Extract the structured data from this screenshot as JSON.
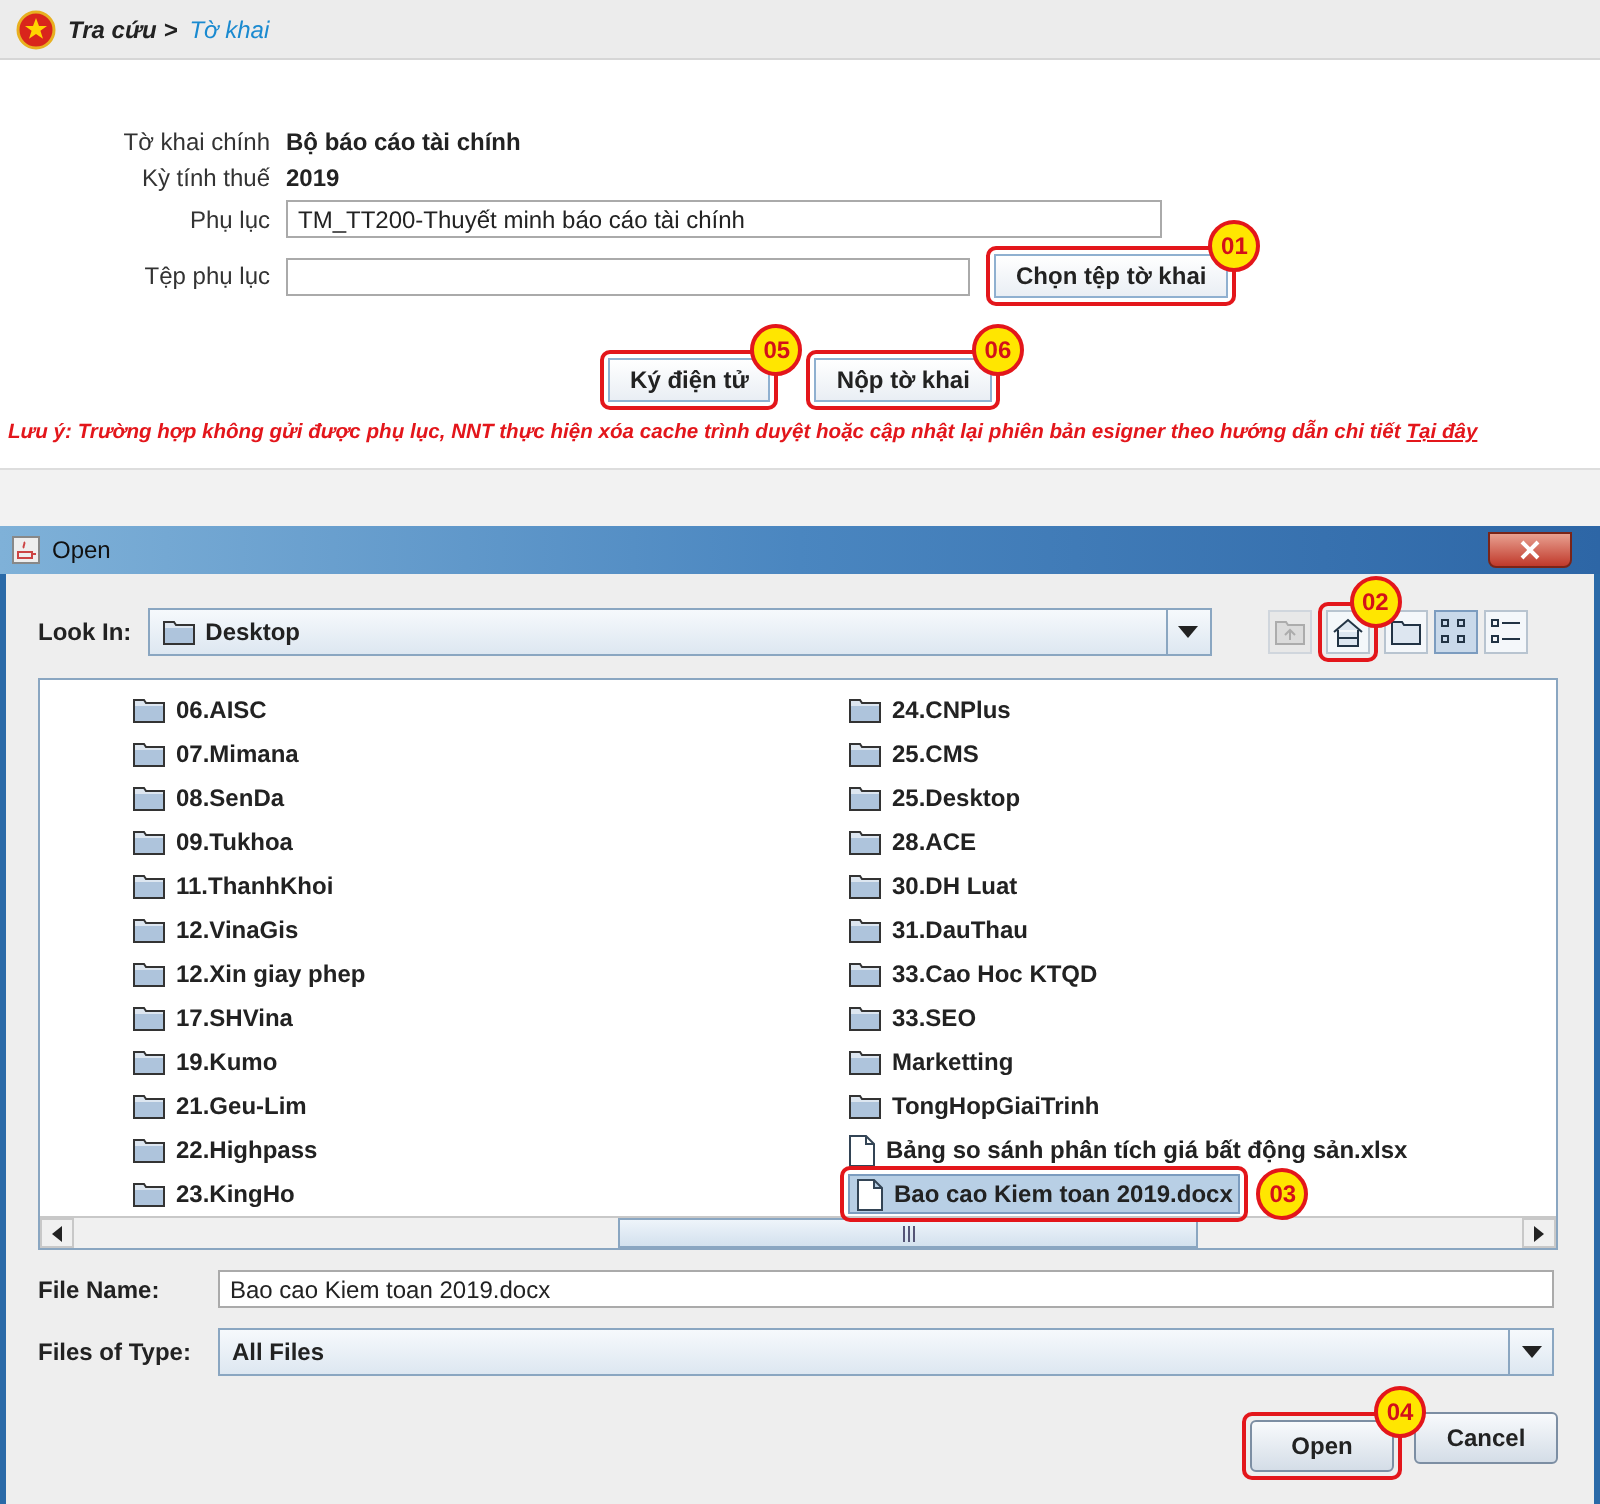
{
  "breadcrumb": {
    "parent": "Tra cứu >",
    "current": "Tờ khai"
  },
  "form": {
    "rows": [
      {
        "kind": "text",
        "label": "Tờ khai chính",
        "value": "Bộ báo cáo tài chính"
      },
      {
        "kind": "text",
        "label": "Kỳ tính thuế",
        "value": "2019"
      },
      {
        "kind": "field",
        "label": "Phụ lục",
        "value": "TM_TT200-Thuyết minh báo cáo tài chính"
      },
      {
        "kind": "file",
        "label": "Tệp phụ lục",
        "button": "Chọn tệp tờ khai",
        "callout": "01"
      }
    ],
    "actions": [
      {
        "label": "Ký điện tử",
        "callout": "05"
      },
      {
        "label": "Nộp tờ khai",
        "callout": "06"
      }
    ],
    "note": {
      "prefix": "Lưu ý:",
      "text": "Trường hợp không gửi được phụ lục, NNT thực hiện xóa cache trình duyệt hoặc cập nhật lại phiên bản esigner theo hướng dẫn chi tiết",
      "link": "Tại đây"
    }
  },
  "dialog": {
    "title": "Open",
    "look_in_label": "Look In:",
    "look_in": "Desktop",
    "toolbar": [
      {
        "kind": "up",
        "disabled": true,
        "selected": false
      },
      {
        "kind": "home",
        "disabled": false,
        "selected": false,
        "callout": "02"
      },
      {
        "kind": "new-folder",
        "disabled": false,
        "selected": false
      },
      {
        "kind": "list",
        "disabled": false,
        "selected": true
      },
      {
        "kind": "details",
        "disabled": false,
        "selected": false
      }
    ],
    "files": [
      {
        "kind": "folder",
        "name": "06.AISC",
        "selected": false
      },
      {
        "kind": "folder",
        "name": "07.Mimana",
        "selected": false
      },
      {
        "kind": "folder",
        "name": "08.SenDa",
        "selected": false
      },
      {
        "kind": "folder",
        "name": "09.Tukhoa",
        "selected": false
      },
      {
        "kind": "folder",
        "name": "11.ThanhKhoi",
        "selected": false
      },
      {
        "kind": "folder",
        "name": "12.VinaGis",
        "selected": false
      },
      {
        "kind": "folder",
        "name": "12.Xin giay phep",
        "selected": false
      },
      {
        "kind": "folder",
        "name": "17.SHVina",
        "selected": false
      },
      {
        "kind": "folder",
        "name": "19.Kumo",
        "selected": false
      },
      {
        "kind": "folder",
        "name": "21.Geu-Lim",
        "selected": false
      },
      {
        "kind": "folder",
        "name": "22.Highpass",
        "selected": false
      },
      {
        "kind": "folder",
        "name": "23.KingHo",
        "selected": false
      },
      {
        "kind": "folder",
        "name": "24.CNPlus",
        "selected": false
      },
      {
        "kind": "folder",
        "name": "25.CMS",
        "selected": false
      },
      {
        "kind": "folder",
        "name": "25.Desktop",
        "selected": false
      },
      {
        "kind": "folder",
        "name": "28.ACE",
        "selected": false
      },
      {
        "kind": "folder",
        "name": "30.DH Luat",
        "selected": false
      },
      {
        "kind": "folder",
        "name": "31.DauThau",
        "selected": false
      },
      {
        "kind": "folder",
        "name": "33.Cao Hoc KTQD",
        "selected": false
      },
      {
        "kind": "folder",
        "name": "33.SEO",
        "selected": false
      },
      {
        "kind": "folder",
        "name": "Marketting",
        "selected": false
      },
      {
        "kind": "folder",
        "name": "TongHopGiaiTrinh",
        "selected": false
      },
      {
        "kind": "file",
        "name": "Bảng so sánh phân tích giá bất động sản.xlsx",
        "selected": false
      },
      {
        "kind": "file",
        "name": "Bao cao Kiem toan 2019.docx",
        "selected": true,
        "callout": "03"
      }
    ],
    "file_name_label": "File Name:",
    "file_name": "Bao cao Kiem toan 2019.docx",
    "type_label": "Files of Type:",
    "type": "All Files",
    "buttons": [
      {
        "label": "Open",
        "callout": "04"
      },
      {
        "label": "Cancel"
      }
    ]
  }
}
